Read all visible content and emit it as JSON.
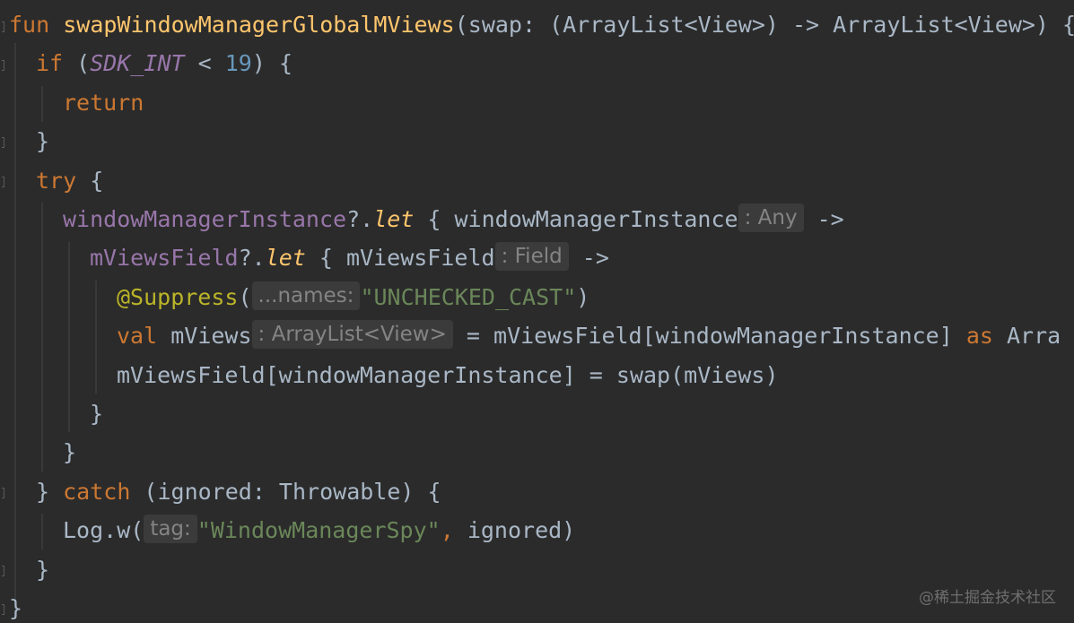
{
  "code_lines": [
    [
      {
        "t": "fun ",
        "c": "k-keyword"
      },
      {
        "t": "swapWindowManagerGlobalMViews",
        "c": "k-fn"
      },
      {
        "t": "(swap: (ArrayList<View>) -> ArrayList<View>) {",
        "c": "k-plain"
      }
    ],
    [
      {
        "t": "if ",
        "c": "k-keyword"
      },
      {
        "t": "(",
        "c": "k-plain"
      },
      {
        "t": "SDK_INT",
        "c": "k-const"
      },
      {
        "t": " < ",
        "c": "k-plain"
      },
      {
        "t": "19",
        "c": "k-num"
      },
      {
        "t": ") {",
        "c": "k-plain"
      }
    ],
    [
      {
        "t": "return",
        "c": "k-keyword"
      }
    ],
    [
      {
        "t": "}",
        "c": "k-plain"
      }
    ],
    [
      {
        "t": "try ",
        "c": "k-keyword"
      },
      {
        "t": "{",
        "c": "k-plain"
      }
    ],
    [
      {
        "t": "windowManagerInstance",
        "c": "k-prop"
      },
      {
        "t": "?.",
        "c": "k-plain"
      },
      {
        "t": "let",
        "c": "k-scope"
      },
      {
        "t": " { windowManagerInstance",
        "c": "k-plain"
      },
      {
        "hint": ": Any"
      },
      {
        "t": " ->",
        "c": "k-plain"
      }
    ],
    [
      {
        "t": "mViewsField",
        "c": "k-prop"
      },
      {
        "t": "?.",
        "c": "k-plain"
      },
      {
        "t": "let",
        "c": "k-scope"
      },
      {
        "t": " { mViewsField",
        "c": "k-plain"
      },
      {
        "hint": ": Field"
      },
      {
        "t": " ->",
        "c": "k-plain"
      }
    ],
    [
      {
        "t": "@Suppress",
        "c": "k-annot"
      },
      {
        "t": "(",
        "c": "k-plain"
      },
      {
        "hint": "...names:"
      },
      {
        "t": "\"UNCHECKED_CAST\"",
        "c": "k-str"
      },
      {
        "t": ")",
        "c": "k-plain"
      }
    ],
    [
      {
        "t": "val ",
        "c": "k-keyword"
      },
      {
        "t": "mViews",
        "c": "k-plain"
      },
      {
        "hint": ": ArrayList<View>"
      },
      {
        "t": " = mViewsField[windowManagerInstance] ",
        "c": "k-plain"
      },
      {
        "t": "as ",
        "c": "k-keyword"
      },
      {
        "t": "Arra",
        "c": "k-plain"
      }
    ],
    [
      {
        "t": "mViewsField[windowManagerInstance] = swap(mViews)",
        "c": "k-plain"
      }
    ],
    [
      {
        "t": "}",
        "c": "k-plain"
      }
    ],
    [
      {
        "t": "}",
        "c": "k-plain"
      }
    ],
    [
      {
        "t": "} ",
        "c": "k-plain"
      },
      {
        "t": "catch ",
        "c": "k-keyword"
      },
      {
        "t": "(ignored: Throwable) {",
        "c": "k-plain"
      }
    ],
    [
      {
        "t": "Log.w(",
        "c": "k-plain"
      },
      {
        "hint": "tag:"
      },
      {
        "t": "\"WindowManagerSpy\"",
        "c": "k-str"
      },
      {
        "t": ", ",
        "c": "k-keyword"
      },
      {
        "t": "ignored)",
        "c": "k-plain"
      }
    ],
    [
      {
        "t": "}",
        "c": "k-plain"
      }
    ],
    [
      {
        "t": "}",
        "c": "k-plain"
      }
    ]
  ],
  "watermark": "@稀土掘金技术社区"
}
